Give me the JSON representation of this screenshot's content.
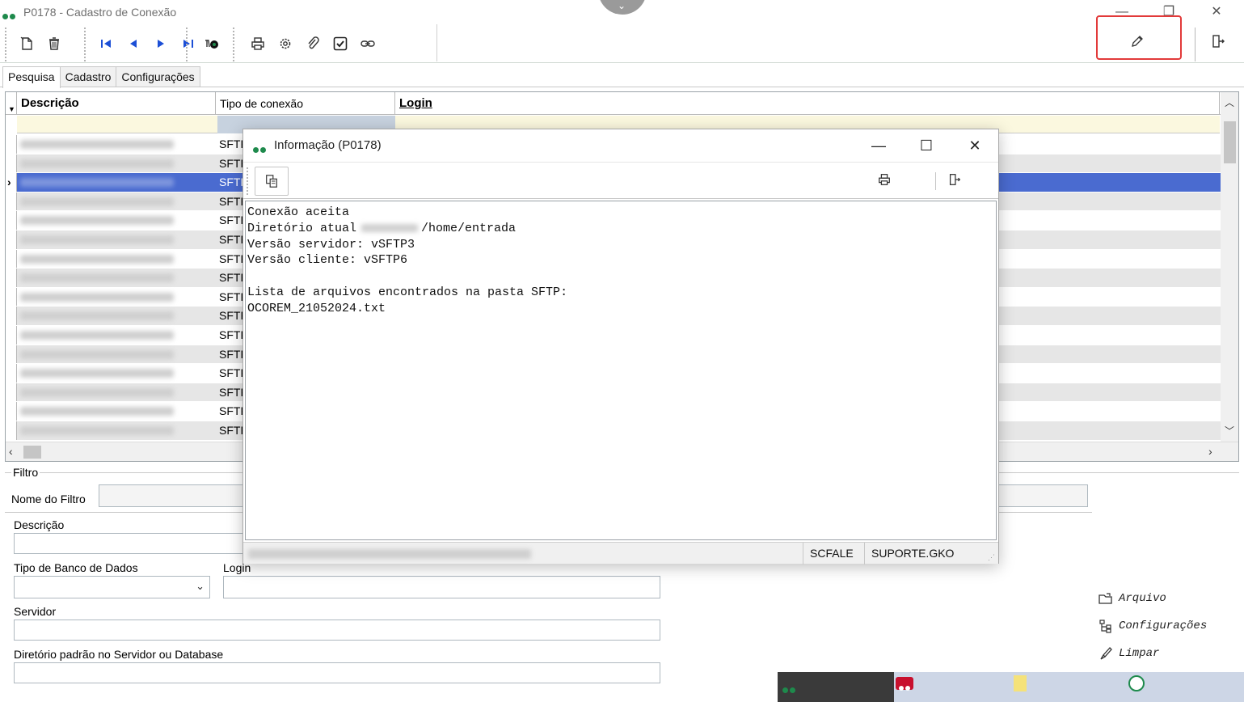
{
  "window": {
    "title": "P0178 - Cadastro de Conexão",
    "minimize": "—",
    "restore": "❐",
    "close": "✕"
  },
  "tabs": [
    "Pesquisa",
    "Cadastro",
    "Configurações"
  ],
  "grid": {
    "columns": [
      "Descrição",
      "Tipo de conexão",
      "Login"
    ],
    "row_type": "SFTF",
    "row_count": 16,
    "selected_index": 2
  },
  "filter_panel": {
    "group_label": "Filtro",
    "nome_do_filtro_label": "Nome do Filtro",
    "descricao_label": "Descrição",
    "tipo_banco_label": "Tipo de Banco de Dados",
    "login_label": "Login",
    "servidor_label": "Servidor",
    "diretorio_label": "Diretório padrão no Servidor ou Database",
    "actions": {
      "arquivo": "Arquivo",
      "configuracoes": "Configurações",
      "limpar": "Limpar"
    }
  },
  "dialog": {
    "title": "Informação (P0178)",
    "minimize": "—",
    "maximize": "☐",
    "close": "✕",
    "lines": {
      "l1": "Conexão aceita",
      "l2a": "Diretório atual",
      "l2b": "/home/entrada",
      "l3": "Versão servidor: vSFTP3",
      "l4": "Versão cliente: vSFTP6",
      "l6": "Lista de arquivos encontrados na pasta SFTP:",
      "l7": "OCOREM_21052024.txt"
    },
    "status": {
      "seg1": "SCFALE",
      "seg2": "SUPORTE.GKO"
    }
  },
  "colors": {
    "selection": "#4a6bd0",
    "filter_row": "#fbf8df",
    "accent_green": "#1e8a4c",
    "highlight_red": "#e23a3a",
    "icon_blue": "#1c4fd6"
  }
}
